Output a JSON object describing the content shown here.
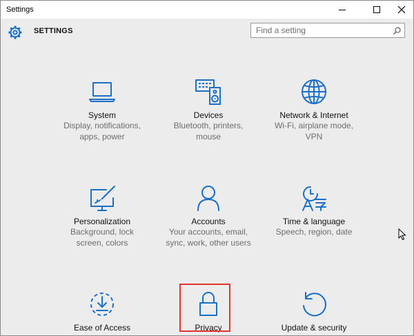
{
  "window": {
    "title": "Settings"
  },
  "header": {
    "title": "SETTINGS"
  },
  "search": {
    "placeholder": "Find a setting"
  },
  "colors": {
    "accent": "#1a6fc7",
    "highlight": "#e0342e"
  },
  "tiles": [
    {
      "name": "System",
      "description": "Display, notifications, apps, power",
      "icon": "laptop-icon"
    },
    {
      "name": "Devices",
      "description": "Bluetooth, printers, mouse",
      "icon": "devices-icon"
    },
    {
      "name": "Network & Internet",
      "description": "Wi-Fi, airplane mode, VPN",
      "icon": "globe-icon"
    },
    {
      "name": "Personalization",
      "description": "Background, lock screen, colors",
      "icon": "personalization-icon"
    },
    {
      "name": "Accounts",
      "description": "Your accounts, email, sync, work, other users",
      "icon": "person-icon"
    },
    {
      "name": "Time & language",
      "description": "Speech, region, date",
      "icon": "time-language-icon"
    },
    {
      "name": "Ease of Access",
      "description": "",
      "icon": "ease-of-access-icon"
    },
    {
      "name": "Privacy",
      "description": "",
      "icon": "lock-icon"
    },
    {
      "name": "Update & security",
      "description": "",
      "icon": "update-icon"
    }
  ]
}
